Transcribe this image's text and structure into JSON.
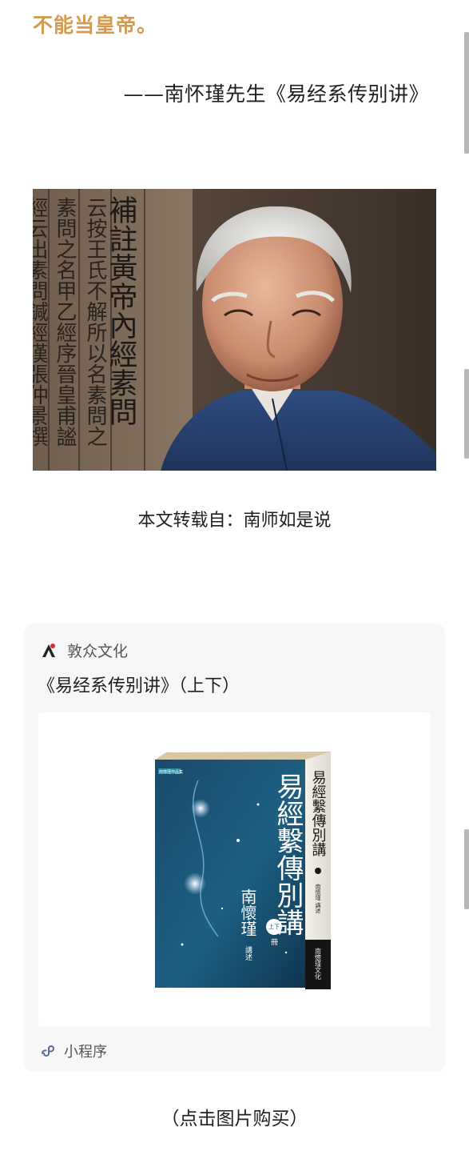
{
  "article": {
    "highlight_text": "不能当皇帝。",
    "quote_source": "——南怀瑾先生《易经系传别讲》",
    "photo": {
      "scripture_lines": [
        "補註黃帝內經素問",
        "云按王氏不解所以名素問之",
        "素問之名甲乙經序晉皇甫謐",
        "經云出素問鍼經漢張仲景撰"
      ]
    },
    "caption": "本文转载自：南师如是说"
  },
  "mini_program_card": {
    "brand_name": "敦众文化",
    "title": "《易经系传别讲》（上下）",
    "book": {
      "front_title": "易經繫傳別講",
      "author": "南懷瑾",
      "author_suffix": "講述",
      "volume_badge": "上下",
      "volume_suffix": "冊",
      "spine_title": "易經繫傳別講",
      "spine_author": "南懷瑾 講述",
      "spine_publisher": "南懷瑾文化",
      "series_label": "南懷瑾作品集"
    },
    "footer_label": "小程序"
  },
  "buy_link": "（点击图片购买）",
  "colors": {
    "highlight": "#d49a4f",
    "text": "#1f1f1f",
    "card_bg": "#f7f7f7",
    "miniprogram_icon": "#576b95"
  }
}
